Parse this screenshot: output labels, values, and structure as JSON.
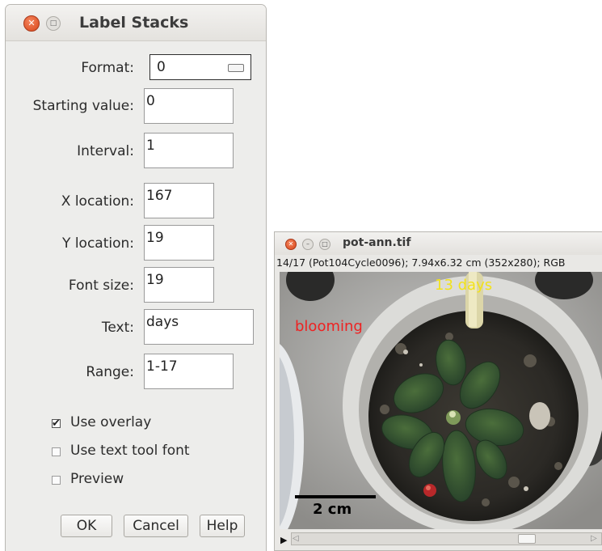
{
  "dialog": {
    "title": "Label Stacks",
    "fields": {
      "format": {
        "label": "Format:",
        "value": "0"
      },
      "starting_value": {
        "label": "Starting value:",
        "value": "0"
      },
      "interval": {
        "label": "Interval:",
        "value": "1"
      },
      "x_location": {
        "label": "X location:",
        "value": "167"
      },
      "y_location": {
        "label": "Y location:",
        "value": "19"
      },
      "font_size": {
        "label": "Font size:",
        "value": "19"
      },
      "text": {
        "label": "Text:",
        "value": "days"
      },
      "range": {
        "label": "Range:",
        "value": "1-17"
      }
    },
    "checkboxes": {
      "use_overlay": {
        "label": "Use overlay",
        "checked": true
      },
      "use_text_tool_font": {
        "label": "Use text tool font",
        "checked": false
      },
      "preview": {
        "label": "Preview",
        "checked": false
      }
    },
    "buttons": {
      "ok": "OK",
      "cancel": "Cancel",
      "help": "Help"
    }
  },
  "image_window": {
    "title": "pot-ann.tif",
    "info": "14/17 (Pot104Cycle0096); 7.94x6.32 cm (352x280); RGB",
    "overlay_label": "13 days",
    "overlay_note": "blooming",
    "scale_bar_label": "2 cm",
    "colors": {
      "overlay_label": "#f2e21a",
      "overlay_note": "#ee2222",
      "scale_bar": "#000000"
    }
  }
}
